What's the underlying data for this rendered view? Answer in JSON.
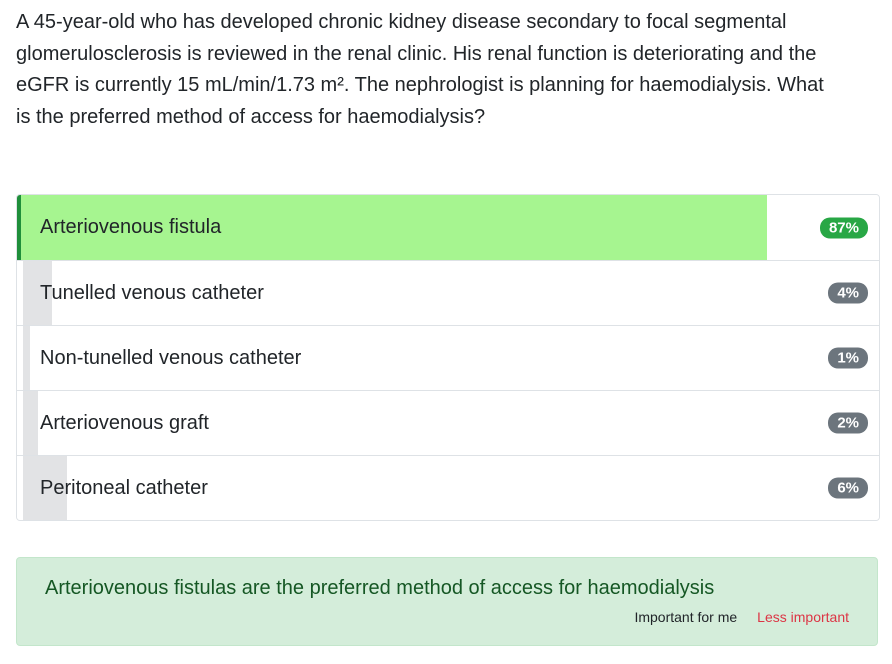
{
  "question": "A 45-year-old who has developed chronic kidney disease secondary to focal segmental glomerulosclerosis is reviewed in the renal clinic. His renal function is deteriorating and the eGFR is currently 15 mL/min/1.73 m². The nephrologist is planning for haemodialysis. What is the preferred method of access for haemodialysis?",
  "options": [
    {
      "label": "Arteriovenous fistula",
      "percent": "87%",
      "share": 87,
      "correct": true
    },
    {
      "label": "Tunelled venous catheter",
      "percent": "4%",
      "share": 4,
      "correct": false
    },
    {
      "label": "Non-tunelled venous catheter",
      "percent": "1%",
      "share": 1,
      "correct": false
    },
    {
      "label": "Arteriovenous graft",
      "percent": "2%",
      "share": 2,
      "correct": false
    },
    {
      "label": "Peritoneal catheter",
      "percent": "6%",
      "share": 6,
      "correct": false
    }
  ],
  "explanation": {
    "text": "Arteriovenous fistulas are the preferred method of access for haemodialysis",
    "important_label": "Important for me",
    "less_important_label": "Less important"
  },
  "colors": {
    "correct_fill": "#a6f590",
    "correct_badge": "#28a745",
    "correct_border": "#1f8f3a",
    "neutral_fill": "#e2e3e5",
    "neutral_badge": "#6c757d",
    "explanation_bg": "#d4edda",
    "less_important": "#dc3545"
  }
}
